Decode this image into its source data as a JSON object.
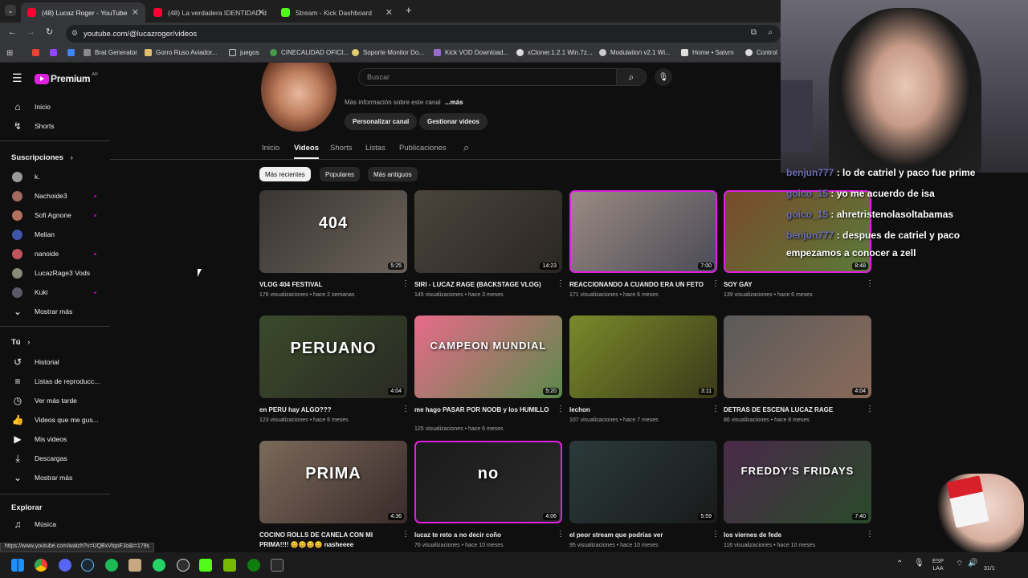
{
  "browser": {
    "tabs": [
      {
        "label": "(48) Lucaz Roger - YouTube",
        "active": true
      },
      {
        "label": "(48) La verdadera IDENTIDAD d",
        "active": false
      },
      {
        "label": "Stream - Kick Dashboard",
        "active": false
      }
    ],
    "url": "youtube.com/@lucazroger/videos",
    "bookmarks": [
      "Brat Generator",
      "Gorro Ruso Aviador...",
      "juegos",
      "CINECALIDAD OFICI...",
      "Soporte Monitor Do...",
      "Kick VOD Download...",
      "xCloner.1.2.1 Win.7z...",
      "Modulation v2.1 Wi...",
      "Home • Satvrn",
      "Control"
    ],
    "status_url": "https://www.youtube.com/watch?v=UQBxVtqoFJo&t=179s"
  },
  "youtube": {
    "logo_text": "Premium",
    "logo_region": "AR",
    "search_placeholder": "Buscar",
    "sidebar": {
      "main": [
        {
          "label": "Inicio",
          "icon": "home-icon"
        },
        {
          "label": "Shorts",
          "icon": "shorts-icon"
        }
      ],
      "subs_title": "Suscripciones",
      "subs": [
        {
          "label": "k.",
          "color": "#9a9a9a",
          "dot": false
        },
        {
          "label": "Nachoide3",
          "color": "#a06b5c",
          "dot": true
        },
        {
          "label": "Sofi Agnone",
          "color": "#b4715d",
          "dot": true
        },
        {
          "label": "Melian",
          "color": "#3e55a8",
          "dot": false
        },
        {
          "label": "nanoide",
          "color": "#c0555f",
          "dot": true
        },
        {
          "label": "LucazRage3 Vods",
          "color": "#8a8a7a",
          "dot": false
        },
        {
          "label": "Kuki",
          "color": "#5a5a66",
          "dot": true
        },
        {
          "label": "Mostrar más",
          "icon": "chevron-down-icon"
        }
      ],
      "you_title": "Tú",
      "you": [
        {
          "label": "Historial",
          "icon": "history-icon"
        },
        {
          "label": "Listas de reproducc...",
          "icon": "playlist-icon"
        },
        {
          "label": "Ver más tarde",
          "icon": "clock-icon"
        },
        {
          "label": "Videos que me gus...",
          "icon": "thumbs-up-icon"
        },
        {
          "label": "Mis videos",
          "icon": "video-icon"
        },
        {
          "label": "Descargas",
          "icon": "download-icon"
        },
        {
          "label": "Mostrar más",
          "icon": "chevron-down-icon"
        }
      ],
      "explore_title": "Explorar",
      "explore": [
        {
          "label": "Música",
          "icon": "music-icon"
        }
      ]
    },
    "channel": {
      "more_info": "Más información sobre este canal",
      "more_link": "...más",
      "customize_button": "Personalizar canal",
      "manage_button": "Gestionar videos",
      "tabs": [
        "Inicio",
        "Videos",
        "Shorts",
        "Listas",
        "Publicaciones"
      ],
      "selected_tab": "Videos"
    },
    "chips": [
      "Más recientes",
      "Populares",
      "Más antiguos"
    ],
    "videos": [
      {
        "title": "VLOG 404 FESTIVAL",
        "views": "176 visualizaciones",
        "age": "hace 2 semanas",
        "duration": "5:25",
        "thumb_colors": [
          "#3a3531",
          "#6b625a"
        ],
        "thumb_text": "404"
      },
      {
        "title": "SIRI - LUCAZ RAGE (BACKSTAGE VLOG)",
        "views": "145 visualizaciones",
        "age": "hace 3 meses",
        "duration": "14:23",
        "thumb_colors": [
          "#4a443c",
          "#2a2622"
        ],
        "thumb_text": ""
      },
      {
        "title": "REACCIONANDO A CUANDO ERA UN FETO",
        "views": "171 visualizaciones",
        "age": "hace 6 meses",
        "duration": "7:00",
        "thumb_colors": [
          "#9b8b83",
          "#4a4a56"
        ],
        "thumb_text": "",
        "pink": true
      },
      {
        "title": "SOY GAY",
        "views": "139 visualizaciones",
        "age": "hace 6 meses",
        "duration": "8:48",
        "thumb_colors": [
          "#7a4a2a",
          "#5a7a3a"
        ],
        "thumb_text": "",
        "pink": true
      },
      {
        "title": "en PERU hay ALGO???",
        "views": "123 visualizaciones",
        "age": "hace 6 meses",
        "duration": "4:04",
        "thumb_colors": [
          "#3a4a2a",
          "#2a2a24"
        ],
        "thumb_text": "PERUANO"
      },
      {
        "title": "me hago PASAR POR NOOB y los HUMILLO",
        "views": "125 visualizaciones",
        "age": "hace 6 meses",
        "duration": "5:20",
        "thumb_colors": [
          "#e86a8a",
          "#5a8a4a"
        ],
        "thumb_text": "CAMPEON MUNDIAL"
      },
      {
        "title": "lechon",
        "views": "107 visualizaciones",
        "age": "hace 7 meses",
        "duration": "3:11",
        "thumb_colors": [
          "#7a8a2a",
          "#3a3a1a"
        ],
        "thumb_text": ""
      },
      {
        "title": "DETRAS DE ESCENA LUCAZ RAGE",
        "views": "86 visualizaciones",
        "age": "hace 8 meses",
        "duration": "4:04",
        "thumb_colors": [
          "#5a5a5a",
          "#8a6a5a"
        ],
        "thumb_text": ""
      },
      {
        "title": "COCINO ROLLS DE CANELA CON MI PRIMA!!!! 😊😊😊😊 nasheeee",
        "views": "",
        "age": "",
        "duration": "4:36",
        "thumb_colors": [
          "#7a6a5a",
          "#3a2a2a"
        ],
        "thumb_text": "PRIMA"
      },
      {
        "title": "lucaz te reto a no decir coño",
        "views": "76 visualizaciones",
        "age": "hace 10 meses",
        "duration": "4:06",
        "thumb_colors": [
          "#1a1a1a",
          "#2a2a2a"
        ],
        "thumb_text": "no",
        "pink": true
      },
      {
        "title": "el peor stream que podrias ver",
        "views": "95 visualizaciones",
        "age": "hace 10 meses",
        "duration": "5:59",
        "thumb_colors": [
          "#2a3a3a",
          "#1a1a1a"
        ],
        "thumb_text": ""
      },
      {
        "title": "los viernes de fede",
        "views": "116 visualizaciones",
        "age": "hace 10 meses",
        "duration": "7:40",
        "thumb_colors": [
          "#4a2a4a",
          "#2a4a2a"
        ],
        "thumb_text": "FREDDY'S FRIDAYS"
      }
    ]
  },
  "chat": [
    {
      "user": "benjun777",
      "text": "lo de catriel y paco fue prime"
    },
    {
      "user": "goico_15",
      "text": "yo me acuerdo de isa"
    },
    {
      "user": "goico_15",
      "text": "ahretristenolasoltabamas"
    },
    {
      "user": "benjun777",
      "text": "despues de catriel y paco"
    },
    {
      "user": "",
      "text": "empezamos a conocer a zell"
    }
  ],
  "taskbar": {
    "lang": "ESP",
    "lang2": "LAA",
    "date": "31/1"
  },
  "colors": {
    "bg": "#0f0f0f",
    "accent_pink": "#e020e0",
    "premium_red": "#ff0033"
  }
}
